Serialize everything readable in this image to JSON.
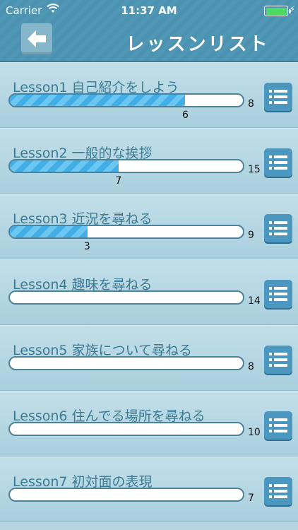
{
  "status": {
    "carrier": "Carrier",
    "time": "11:37 AM"
  },
  "nav": {
    "title": "レッスンリスト",
    "back_icon": "arrow-left-icon"
  },
  "colors": {
    "header": "#4b93b1",
    "progress_fill": "#43aee6",
    "title_text": "#3d7a93",
    "list_button": "#4b97bf"
  },
  "lessons": [
    {
      "title": "Lesson1 自己紹介をしよう",
      "done": 6,
      "done_label": "6",
      "total": 8,
      "total_label": "8"
    },
    {
      "title": "Lesson2 一般的な挨拶",
      "done": 7,
      "done_label": "7",
      "total": 15,
      "total_label": "15"
    },
    {
      "title": "Lesson3 近況を尋ねる",
      "done": 3,
      "done_label": "3",
      "total": 9,
      "total_label": "9"
    },
    {
      "title": "Lesson4 趣味を尋ねる",
      "done": 0,
      "done_label": "",
      "total": 14,
      "total_label": "14"
    },
    {
      "title": "Lesson5 家族について尋ねる",
      "done": 0,
      "done_label": "",
      "total": 8,
      "total_label": "8"
    },
    {
      "title": "Lesson6 住んでる場所を尋ねる",
      "done": 0,
      "done_label": "",
      "total": 10,
      "total_label": "10"
    },
    {
      "title": "Lesson7 初対面の表現",
      "done": 0,
      "done_label": "",
      "total": 7,
      "total_label": "7"
    }
  ]
}
